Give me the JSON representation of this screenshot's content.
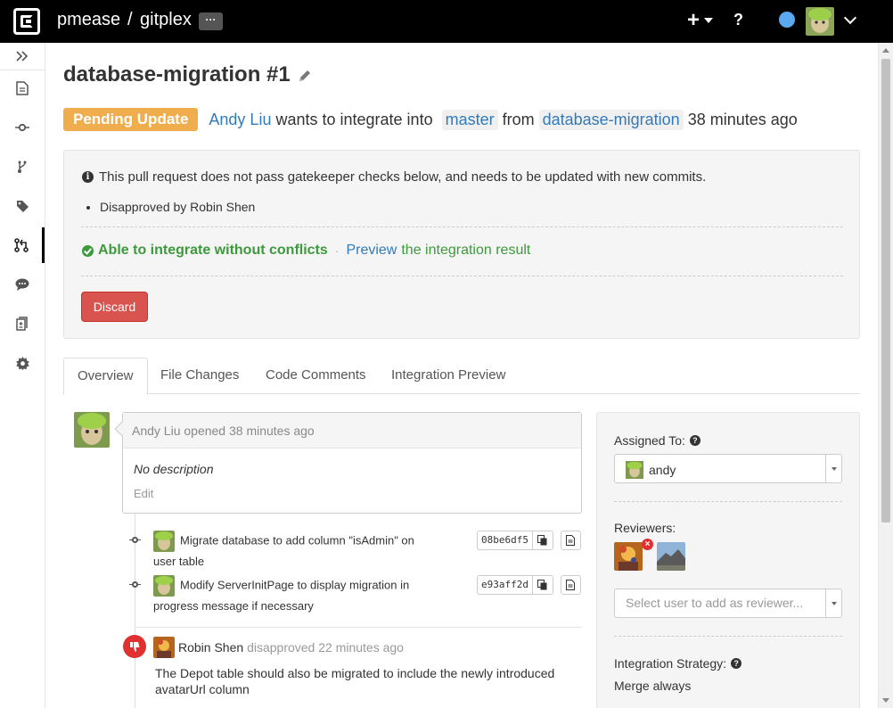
{
  "header": {
    "owner": "pmease",
    "separator": "/",
    "repo": "gitplex",
    "more_label": "···",
    "plus_label": "+",
    "help_label": "?"
  },
  "sidebar": {
    "items": [
      {
        "icon": "files-icon"
      },
      {
        "icon": "commits-icon"
      },
      {
        "icon": "branches-icon"
      },
      {
        "icon": "tags-icon"
      },
      {
        "icon": "pull-requests-icon",
        "active": true
      },
      {
        "icon": "comments-icon"
      },
      {
        "icon": "compare-icon"
      },
      {
        "icon": "settings-icon"
      }
    ]
  },
  "request": {
    "title": "database-migration #1",
    "status": "Pending Update",
    "author": "Andy Liu",
    "verb": "wants to integrate into",
    "target_branch": "master",
    "from_word": "from",
    "source_branch": "database-migration",
    "time": "38 minutes ago"
  },
  "checks": {
    "message": "This pull request does not pass gatekeeper checks below, and needs to be updated with new commits.",
    "items": [
      "Disapproved by Robin Shen"
    ],
    "conflict_status": "Able to integrate without conflicts",
    "separator": "·",
    "preview_link": "Preview",
    "preview_rest": "the integration result",
    "discard_label": "Discard"
  },
  "tabs": [
    {
      "label": "Overview",
      "active": true
    },
    {
      "label": "File Changes"
    },
    {
      "label": "Code Comments"
    },
    {
      "label": "Integration Preview"
    }
  ],
  "activity": {
    "opened_header": "Andy Liu opened 38 minutes ago",
    "description": "No description",
    "edit_label": "Edit",
    "commits": [
      {
        "message": "Migrate database to add column \"isAdmin\" on user table",
        "hash": "08be6df5"
      },
      {
        "message": "Modify ServerInitPage to display migration in progress message if necessary",
        "hash": "e93aff2d"
      }
    ],
    "review": {
      "user": "Robin Shen",
      "action": "disapproved 22 minutes ago",
      "comment": "The Depot table should also be migrated to include the newly introduced avatarUrl column"
    }
  },
  "side_panel": {
    "assigned_label": "Assigned To:",
    "assignee": "andy",
    "reviewers_label": "Reviewers:",
    "reviewer_placeholder": "Select user to add as reviewer...",
    "strategy_label": "Integration Strategy:",
    "strategy_value": "Merge always"
  },
  "colors": {
    "pending": "#f0ad4e",
    "success": "#3c9a3c",
    "danger": "#d9534f",
    "link": "#337ab7"
  }
}
